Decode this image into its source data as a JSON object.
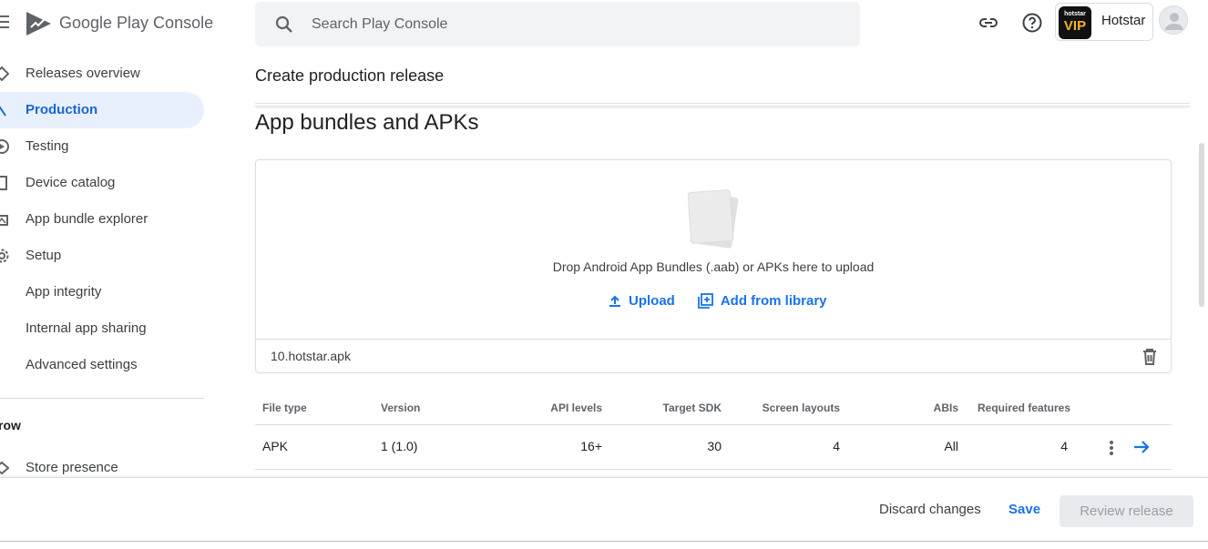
{
  "header": {
    "brand": "Google Play Console",
    "search_placeholder": "Search Play Console",
    "app_name": "Hotstar",
    "app_logo_line1": "hotstar",
    "app_logo_line2": "VIP"
  },
  "sidebar": {
    "items": [
      {
        "label": "Releases overview",
        "icon": "releases-icon"
      },
      {
        "label": "Production",
        "icon": "production-icon",
        "active": true
      },
      {
        "label": "Testing",
        "icon": "testing-icon"
      },
      {
        "label": "Device catalog",
        "icon": "device-icon"
      },
      {
        "label": "App bundle explorer",
        "icon": "bundle-explorer-icon"
      },
      {
        "label": "Setup",
        "icon": "gear-icon"
      },
      {
        "label": "App integrity"
      },
      {
        "label": "Internal app sharing"
      },
      {
        "label": "Advanced settings"
      }
    ],
    "section_label": "row",
    "store_presence": "Store presence"
  },
  "main": {
    "page_title": "Create production release",
    "section_title": "App bundles and APKs",
    "dropzone_text": "Drop Android App Bundles (.aab) or APKs here to upload",
    "upload_label": "Upload",
    "library_label": "Add from library",
    "file_name": "10.hotstar.apk"
  },
  "table": {
    "headers": [
      "File type",
      "Version",
      "API levels",
      "Target SDK",
      "Screen layouts",
      "ABIs",
      "Required features"
    ],
    "row": [
      "APK",
      "1 (1.0)",
      "16+",
      "30",
      "4",
      "All",
      "4"
    ]
  },
  "footer": {
    "discard": "Discard changes",
    "save": "Save",
    "review": "Review release"
  },
  "colors": {
    "accent": "#1a73e8",
    "active_bg": "#e8f0fe",
    "disabled_bg": "#e8eaed"
  }
}
